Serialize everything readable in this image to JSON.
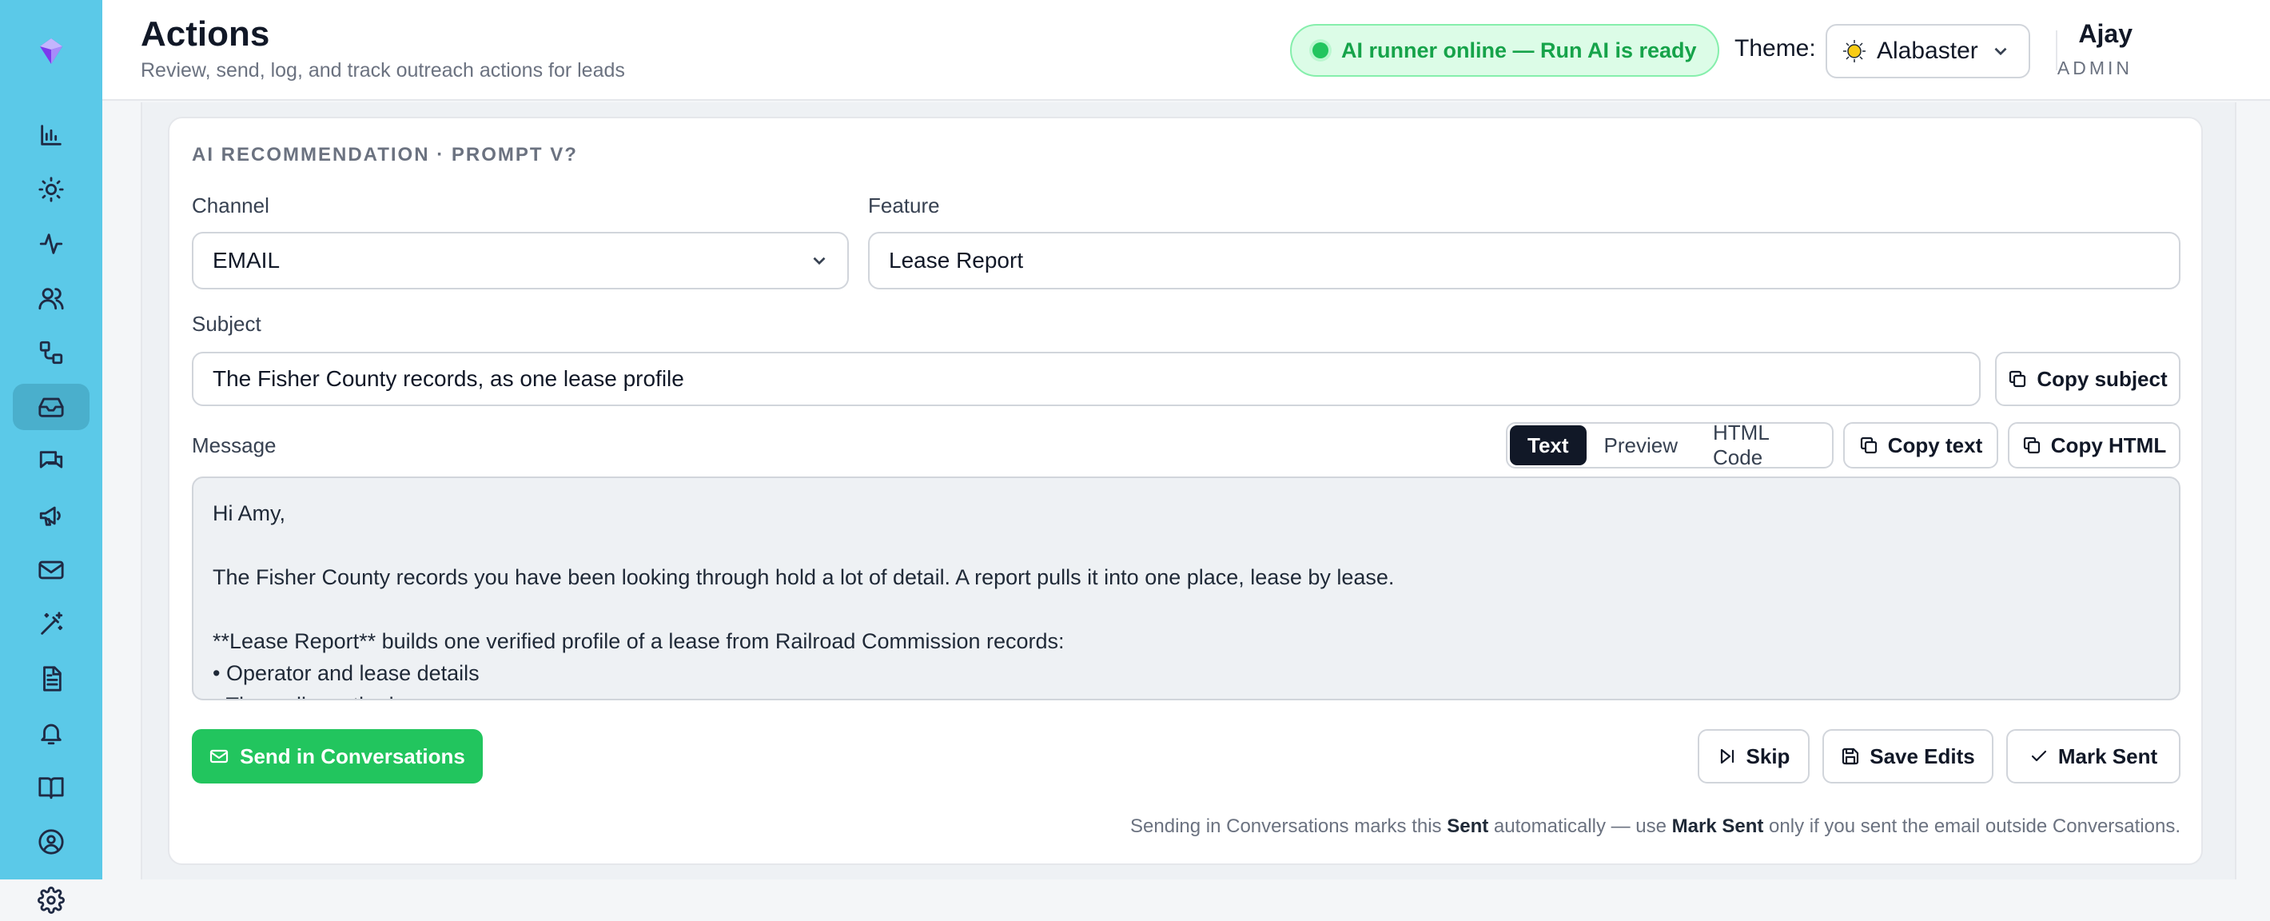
{
  "header": {
    "title": "Actions",
    "subtitle": "Review, send, log, and track outreach actions for leads",
    "status": "AI runner online — Run AI is ready",
    "theme_label": "Theme:",
    "theme_value": "Alabaster",
    "user_name": "Ajay",
    "user_role": "ADMIN"
  },
  "sidebar": {
    "items": [
      {
        "icon": "bar-chart-icon"
      },
      {
        "icon": "sun-icon"
      },
      {
        "icon": "activity-icon"
      },
      {
        "icon": "users-icon"
      },
      {
        "icon": "workflow-icon"
      },
      {
        "icon": "inbox-icon",
        "active": true
      },
      {
        "icon": "messages-icon"
      },
      {
        "icon": "megaphone-icon"
      },
      {
        "icon": "mail-icon"
      },
      {
        "icon": "magic-wand-icon"
      },
      {
        "icon": "document-icon"
      },
      {
        "icon": "bell-icon"
      },
      {
        "icon": "book-icon"
      },
      {
        "icon": "user-circle-icon"
      },
      {
        "icon": "gear-icon"
      }
    ]
  },
  "recommendation": {
    "section_label": "AI RECOMMENDATION · PROMPT V?",
    "channel_label": "Channel",
    "channel_value": "EMAIL",
    "feature_label": "Feature",
    "feature_value": "Lease Report",
    "subject_label": "Subject",
    "subject_value": "The Fisher County records, as one lease profile",
    "copy_subject": "Copy subject",
    "message_label": "Message",
    "tabs": [
      "Text",
      "Preview",
      "HTML Code"
    ],
    "active_tab": "Text",
    "copy_text": "Copy text",
    "copy_html": "Copy HTML",
    "message_lines": [
      "Hi Amy,",
      "",
      "The Fisher County records you have been looking through hold a lot of detail. A report pulls it into one place, lease by lease.",
      "",
      "**Lease Report** builds one verified profile of a lease from Railroad Commission records:",
      "• Operator and lease details",
      "• The wells on the lease"
    ]
  },
  "actions": {
    "send": "Send in Conversations",
    "skip": "Skip",
    "save": "Save Edits",
    "mark_sent": "Mark Sent"
  },
  "footnote": {
    "part1": "Sending in Conversations marks this ",
    "bold1": "Sent",
    "part2": " automatically — use ",
    "bold2": "Mark Sent",
    "part3": " only if you sent the email outside Conversations."
  },
  "colors": {
    "sidebar": "#5bc9e8",
    "accent_green": "#22c55e",
    "status_bg": "#dcfce7"
  }
}
